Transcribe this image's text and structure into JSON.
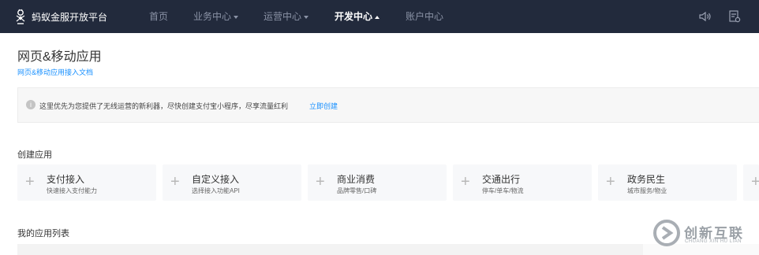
{
  "nav": {
    "brand": "蚂蚁金服开放平台",
    "items": [
      {
        "label": "首页",
        "dropdown": false,
        "active": false
      },
      {
        "label": "业务中心",
        "dropdown": true,
        "active": false
      },
      {
        "label": "运营中心",
        "dropdown": true,
        "active": false
      },
      {
        "label": "开发中心",
        "dropdown": true,
        "active": true
      },
      {
        "label": "账户中心",
        "dropdown": false,
        "active": false
      }
    ],
    "icons": [
      "speaker-icon",
      "document-icon"
    ]
  },
  "page": {
    "title": "网页&移动应用",
    "doc_link": "网页&移动应用接入文档"
  },
  "notice": {
    "icon": "info-icon",
    "text": "这里优先为您提供了无线运营的新利器，尽快创建支付宝小程序，尽享流量红利",
    "link": "立即创建"
  },
  "create": {
    "title": "创建应用",
    "cards": [
      {
        "title": "支付接入",
        "subtitle": "快速接入支付能力"
      },
      {
        "title": "自定义接入",
        "subtitle": "选择接入功能API"
      },
      {
        "title": "商业消费",
        "subtitle": "品牌零售/口碑"
      },
      {
        "title": "交通出行",
        "subtitle": "停车/单车/物流"
      },
      {
        "title": "政务民生",
        "subtitle": "城市服务/物业"
      }
    ]
  },
  "my_apps": {
    "title": "我的应用列表"
  },
  "watermark": {
    "text": "创新互联",
    "sub": "CHUANG XIN HU LIAN"
  },
  "colors": {
    "nav_bg": "#222a3c",
    "link": "#1890ff",
    "card_bg": "#f7f8fa"
  }
}
